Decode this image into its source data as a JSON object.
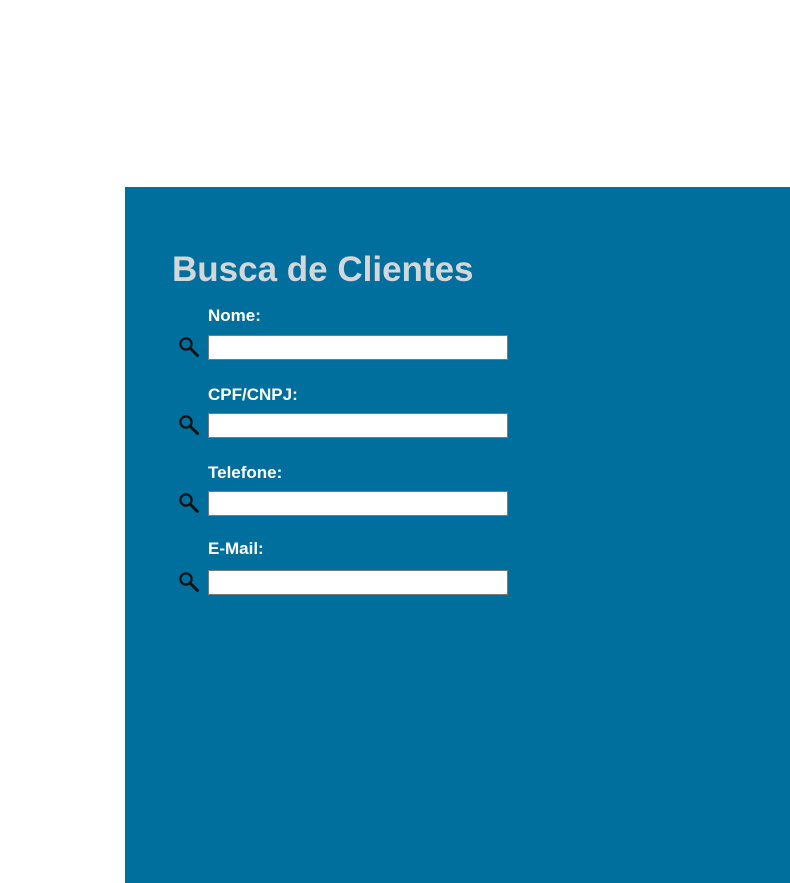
{
  "page": {
    "title": "Busca de Clientes"
  },
  "fields": [
    {
      "label": "Nome:",
      "value": "",
      "icon": "search-icon"
    },
    {
      "label": "CPF/CNPJ:",
      "value": "",
      "icon": "search-icon"
    },
    {
      "label": "Telefone:",
      "value": "",
      "icon": "search-icon"
    },
    {
      "label": "E-Mail:",
      "value": "",
      "icon": "search-icon"
    }
  ],
  "colors": {
    "panel_background": "#016f9e",
    "title_text": "#d3d7da",
    "label_text": "#ffffff",
    "input_border": "#7a7a7a"
  }
}
